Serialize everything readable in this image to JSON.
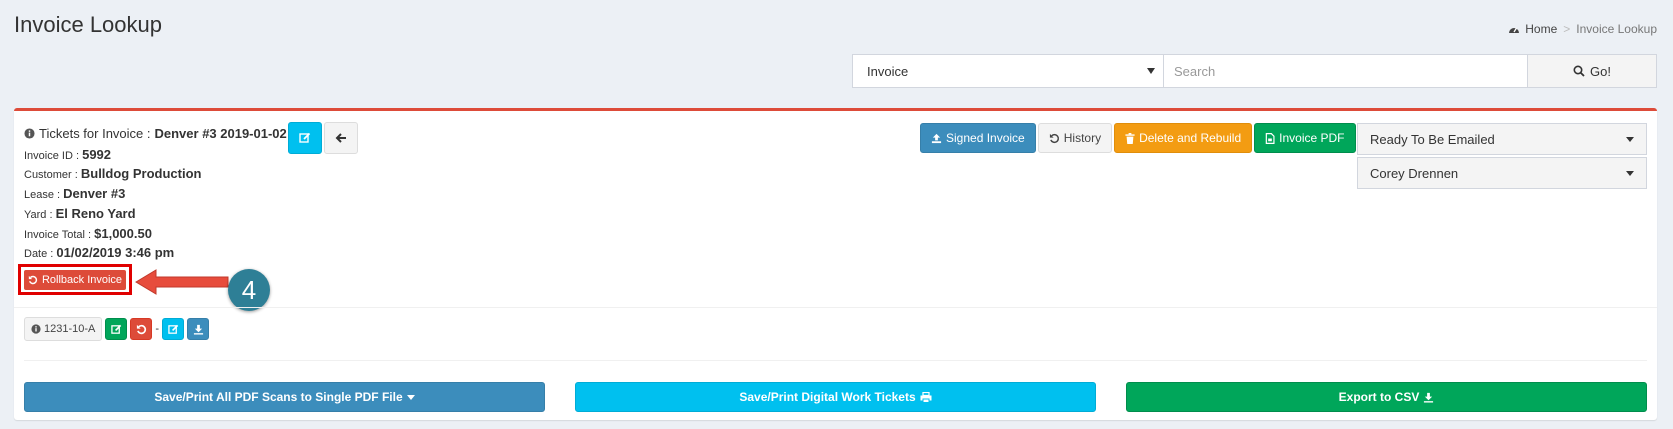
{
  "header": {
    "title": "Invoice Lookup",
    "breadcrumb": {
      "home": "Home",
      "separator": ">",
      "current": "Invoice Lookup"
    }
  },
  "search": {
    "type_selected": "Invoice",
    "placeholder": "Search",
    "go_label": "Go!"
  },
  "invoice": {
    "tickets_label": "Tickets for Invoice :",
    "tickets_name": "Denver #3 2019-01-02",
    "details": [
      {
        "label": "Invoice ID :",
        "value": "5992"
      },
      {
        "label": "Customer :",
        "value": "Bulldog Production"
      },
      {
        "label": "Lease :",
        "value": "Denver #3"
      },
      {
        "label": "Yard :",
        "value": "El Reno Yard"
      },
      {
        "label": "Invoice Total :",
        "value": "$1,000.50"
      },
      {
        "label": "Date :",
        "value": "01/02/2019 3:46 pm"
      }
    ],
    "rollback_label": "Rollback Invoice"
  },
  "annotation": {
    "step": "4"
  },
  "actions": {
    "signed_invoice": "Signed Invoice",
    "history": "History",
    "delete_rebuild": "Delete and Rebuild",
    "invoice_pdf": "Invoice PDF"
  },
  "status": {
    "state": "Ready To Be Emailed",
    "assignee": "Corey Drennen"
  },
  "ticket": {
    "number": "1231-10-A",
    "separator": "-"
  },
  "bottom": {
    "save_pdf": "Save/Print All PDF Scans to Single PDF File",
    "save_digital": "Save/Print Digital Work Tickets",
    "export_csv": "Export to CSV"
  },
  "colors": {
    "box_accent": "#dd4b39",
    "primary": "#3c8dbc",
    "info": "#00c0ef",
    "success": "#00a65a",
    "warning": "#f39c12",
    "danger": "#dd4b39",
    "annotation_circle": "#2e7f96",
    "annotation_arrow": "#e74c3c"
  }
}
